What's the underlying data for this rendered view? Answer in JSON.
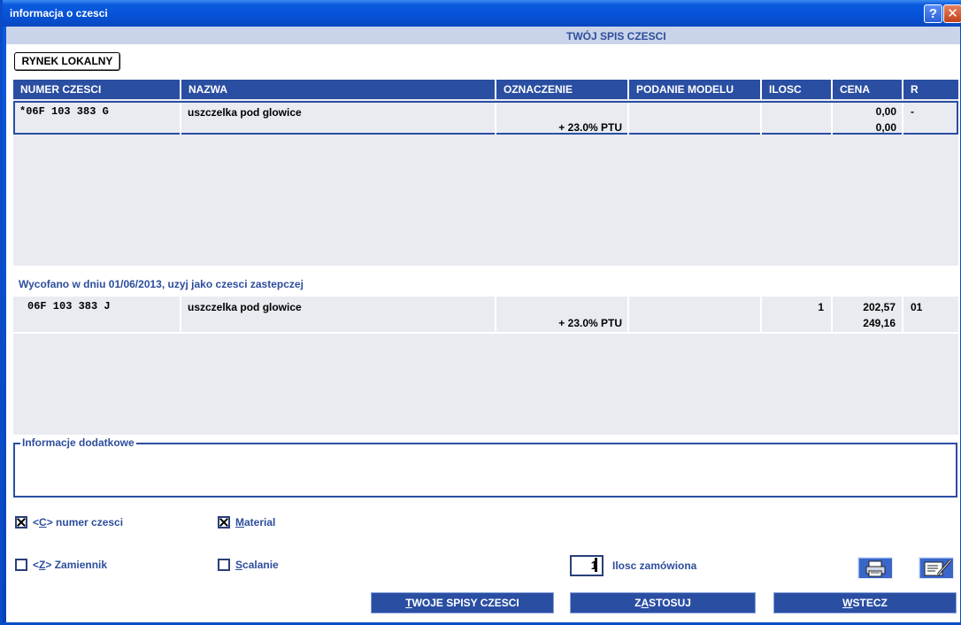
{
  "window": {
    "title": "informacja o czesci",
    "help_btn": "?",
    "close_btn": "✕"
  },
  "subtitle": "TWÓJ SPIS CZESCI",
  "market_button": "RYNEK LOKALNY",
  "table": {
    "columns": [
      "NUMER CZESCI",
      "NAZWA",
      "OZNACZENIE",
      "PODANIE MODELU",
      "ILOSC",
      "CENA",
      "R"
    ],
    "rows": [
      {
        "part_number": "*06F 103 383 G",
        "name": "uszczelka pod glowice",
        "designation": "+ 23.0% PTU",
        "model": "",
        "qty": "",
        "price_net": "0,00",
        "price_gross": "0,00",
        "r": "-"
      }
    ]
  },
  "replaced_notice": "Wycofano w dniu 01/06/2013, uzyj jako czesci zastepczej",
  "replacement_table": {
    "rows": [
      {
        "part_number": "06F 103 383 J",
        "name": "uszczelka pod glowice",
        "designation": "+ 23.0% PTU",
        "model": "",
        "qty": "1",
        "price_net": "202,57",
        "price_gross": "249,16",
        "r": "01"
      }
    ]
  },
  "info_box": {
    "legend": "Informacje dodatkowe"
  },
  "options": {
    "part_number": {
      "prefix": "<",
      "key": "C",
      "suffix": "> numer czesci",
      "checked": true
    },
    "material": {
      "key": "M",
      "rest": "aterial",
      "checked": true
    },
    "substitute": {
      "prefix": "<",
      "key": "Z",
      "suffix": "> Zamiennik",
      "checked": false
    },
    "merge": {
      "key": "S",
      "rest": "calanie",
      "checked": false
    }
  },
  "order": {
    "quantity": "1",
    "label": "Ilosc zamówiona"
  },
  "icons": {
    "print": "printer-icon",
    "edit": "edit-document-icon"
  },
  "buttons": {
    "lists": {
      "key": "T",
      "rest": "WOJE SPISY CZESCI"
    },
    "apply": {
      "pre": "Z",
      "key": "A",
      "rest": "STOSUJ"
    },
    "back": {
      "key": "W",
      "rest": "STECZ"
    }
  }
}
